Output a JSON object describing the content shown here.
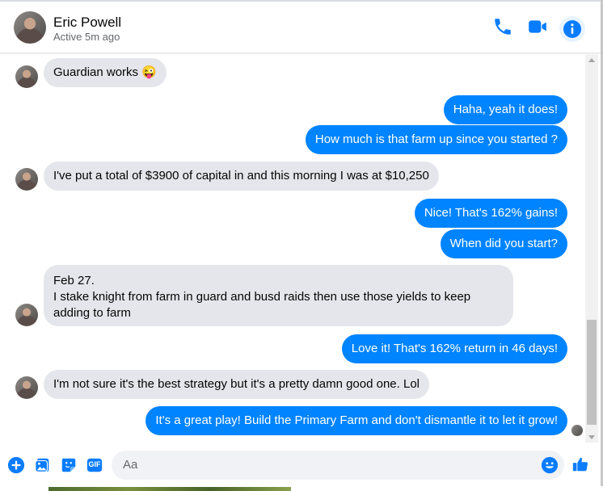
{
  "header": {
    "name": "Eric Powell",
    "status": "Active 5m ago",
    "icons": [
      "phone-icon",
      "video-camera-icon",
      "info-icon"
    ]
  },
  "messages": [
    {
      "from": "contact",
      "text": "Guardian works 😜",
      "avatar": true
    },
    {
      "from": "me",
      "text": "Haha, yeah it does!"
    },
    {
      "from": "me",
      "text": "How much is that farm up since you started ?"
    },
    {
      "from": "contact",
      "text": "I've put a total of $3900 of capital in and this morning I was at $10,250",
      "avatar": true
    },
    {
      "from": "me",
      "text": "Nice! That's 162% gains!"
    },
    {
      "from": "me",
      "text": "When did you start?"
    },
    {
      "from": "contact",
      "lines": [
        "Feb 27.",
        "I stake knight from farm in guard and busd raids then use those yields to keep adding to farm"
      ],
      "avatar": true
    },
    {
      "from": "me",
      "text": "Love it! That's 162% return in 46 days!"
    },
    {
      "from": "contact",
      "text": "I'm not sure it's the best strategy but it's a pretty damn good one. Lol",
      "avatar": true
    },
    {
      "from": "me",
      "text": "It's a great play! Build the Primary Farm and don't dismantle it to let it grow!"
    }
  ],
  "composer": {
    "placeholder": "Aa",
    "value": "",
    "icons": [
      "plus-icon",
      "photo-icon",
      "sticker-icon",
      "gif-icon",
      "emoji-icon",
      "thumbs-up-icon"
    ],
    "gif_label": "GIF"
  },
  "colors": {
    "accent": "#0084ff",
    "icon_blue": "#0a7cff",
    "incoming_bubble": "#e4e6eb",
    "outgoing_bubble": "#0084ff"
  }
}
